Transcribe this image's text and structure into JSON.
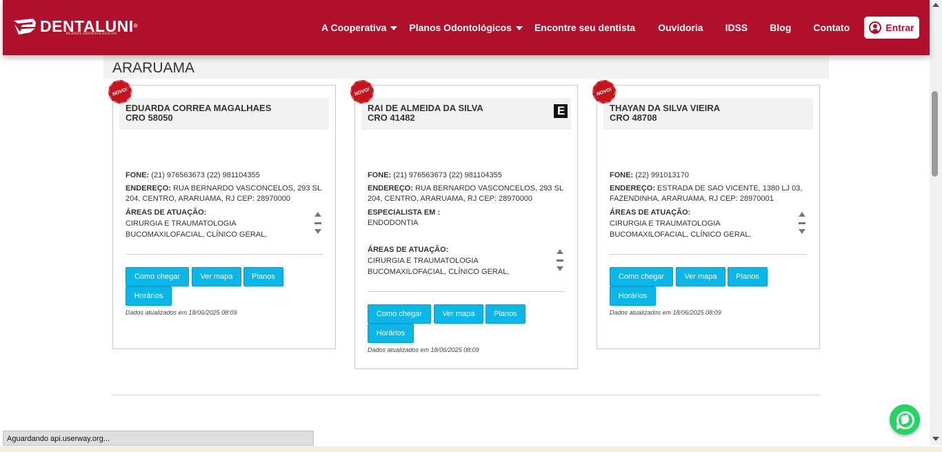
{
  "header": {
    "logo": {
      "name": "DENTALUNI",
      "subtitle": "PLANOS ODONTOLÓGICOS",
      "reg": "®"
    },
    "nav": [
      {
        "label": "A Cooperativa",
        "dropdown": true
      },
      {
        "label": "Planos Odontológicos",
        "dropdown": true
      },
      {
        "label": "Encontre seu dentista",
        "dropdown": false
      },
      {
        "label": "Ouvidoria",
        "dropdown": false
      },
      {
        "label": "IDSS",
        "dropdown": false
      },
      {
        "label": "Blog",
        "dropdown": false
      },
      {
        "label": "Contato",
        "dropdown": false
      }
    ],
    "login_label": "Entrar"
  },
  "city": "ARARUAMA",
  "badge_label": "NOVO!",
  "labels": {
    "phone": "FONE:",
    "address": "ENDEREÇO:",
    "areas": "ÁREAS DE ATUAÇÃO:",
    "specialist": "ESPECIALISTA EM :"
  },
  "cards": [
    {
      "name": "EDUARDA CORREA MAGALHAES",
      "cro": "CRO 58050",
      "phone": "(21) 976563673 (22) 981104355",
      "address_line1": "RUA BERNARDO VASCONCELOS, 293 SL",
      "address_line2": "204, CENTRO, ARARUAMA, RJ CEP: 28970000",
      "areas": "CIRURGIA E TRAUMATOLOGIA BUCOMAXILOFACIAL, CLÍNICO GERAL,",
      "buttons": [
        "Como chegar",
        "Ver mapa",
        "Planos",
        "Horários"
      ],
      "updated": "Dados atualizados em 18/06/2025 08:09"
    },
    {
      "name": "RAI DE ALMEIDA DA SILVA",
      "cro": "CRO 41482",
      "phone": "(21) 976563673 (22) 981104355",
      "address_line1": "RUA BERNARDO VASCONCELOS, 293 SL",
      "address_line2": "204, CENTRO, ARARUAMA, RJ CEP: 28970000",
      "specialist": "ENDODONTIA",
      "areas": "CIRURGIA E TRAUMATOLOGIA BUCOMAXILOFACIAL, CLÍNICO GERAL,",
      "buttons": [
        "Como chegar",
        "Ver mapa",
        "Planos",
        "Horários"
      ],
      "updated": "Dados atualizados em 18/06/2025 08:09"
    },
    {
      "name": "THAYAN DA SILVA VIEIRA",
      "cro": "CRO 48708",
      "phone": "(22) 991013170",
      "address_line1": "ESTRADA DE SAO VICENTE, 1380 LJ 03,",
      "address_line2": "FAZENDINHA, ARARUAMA, RJ CEP: 28970001",
      "areas": "CIRURGIA E TRAUMATOLOGIA BUCOMAXILOFACIAL, CLÍNICO GERAL,",
      "buttons": [
        "Como chegar",
        "Ver mapa",
        "Planos",
        "Horários"
      ],
      "updated": "Dados atualizados em 18/06/2025 08:09"
    }
  ],
  "statusbar": "Aguardando api.userway.org...",
  "colors": {
    "brand": "#b0102c",
    "button": "#0bb6e8",
    "whatsapp": "#25d366"
  }
}
